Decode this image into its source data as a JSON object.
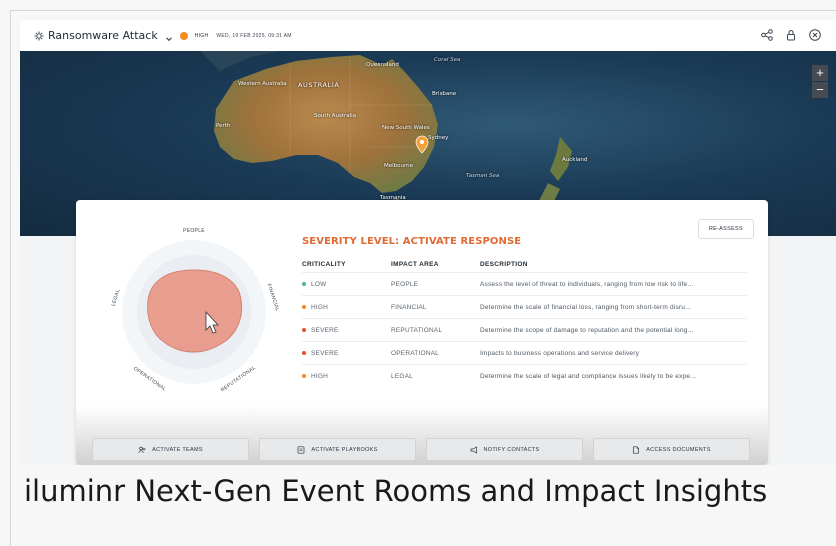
{
  "header": {
    "title": "Ransomware Attack",
    "severity": "HIGH",
    "date": "WED, 19 FEB 2025, 09:31 AM",
    "severity_color": "#f28b1e",
    "icons": [
      "settings-icon",
      "chevron-down-icon",
      "share-icon",
      "lock-icon",
      "close-icon"
    ]
  },
  "map": {
    "zoom_in": "+",
    "zoom_out": "−",
    "labels": {
      "australia": "AUSTRALIA",
      "western_australia": "Western Australia",
      "queensland": "Queensland",
      "coral_sea": "Coral Sea",
      "south_australia": "South Australia",
      "new_south_wales": "New South Wales",
      "perth": "Perth",
      "brisbane": "Brisbane",
      "sydney": "Sydney",
      "melbourne": "Melbourne",
      "auckland": "Auckland",
      "tasman_sea": "Tasman Sea",
      "tasmania": "Tasmania"
    }
  },
  "panel": {
    "reassess_label": "RE-ASSESS",
    "severity_heading": "SEVERITY LEVEL: ACTIVATE RESPONSE",
    "columns": [
      "CRITICALITY",
      "IMPACT AREA",
      "DESCRIPTION"
    ],
    "rows": [
      {
        "criticality": "LOW",
        "area": "PEOPLE",
        "description": "Assess the level of threat to individuals, ranging from low risk to life...",
        "color": "#4cb39a"
      },
      {
        "criticality": "HIGH",
        "area": "FINANCIAL",
        "description": "Determine the scale of financial loss, ranging from short-term disru...",
        "color": "#f28b1e"
      },
      {
        "criticality": "SEVERE",
        "area": "REPUTATIONAL",
        "description": "Determine the scope of damage to reputation and the potential long...",
        "color": "#e0502c"
      },
      {
        "criticality": "SEVERE",
        "area": "OPERATIONAL",
        "description": "Impacts to business operations and service delivery",
        "color": "#e0502c"
      },
      {
        "criticality": "HIGH",
        "area": "LEGAL",
        "description": "Determine the scale of legal and compliance issues likely to be expe...",
        "color": "#f28b1e"
      }
    ],
    "radar_labels": {
      "people": "PEOPLE",
      "financial": "FINANCIAL",
      "reputational": "REPUTATIONAL",
      "operational": "OPERATIONAL",
      "legal": "LEGAL"
    },
    "radar_fill_color": "#e99a8a"
  },
  "actions": [
    {
      "label": "ACTIVATE TEAMS",
      "icon": "users-icon"
    },
    {
      "label": "ACTIVATE PLAYBOOKS",
      "icon": "playbook-icon"
    },
    {
      "label": "NOTIFY CONTACTS",
      "icon": "megaphone-icon"
    },
    {
      "label": "ACCESS DOCUMENTS",
      "icon": "document-icon"
    }
  ],
  "caption": "iluminr Next-Gen Event Rooms and Impact Insights"
}
